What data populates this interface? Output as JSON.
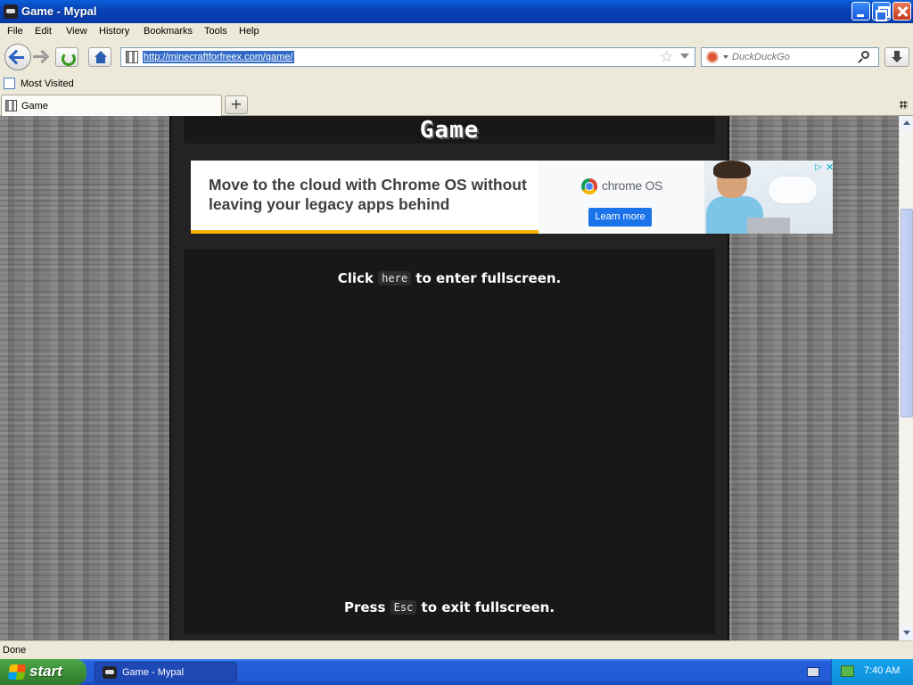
{
  "window": {
    "title": "Game - Mypal"
  },
  "menu": [
    "File",
    "Edit",
    "View",
    "History",
    "Bookmarks",
    "Tools",
    "Help"
  ],
  "toolbar": {
    "url": "http://minecraftforfreex.com/game/",
    "search_placeholder": "DuckDuckGo"
  },
  "bookmarks": {
    "most_visited": "Most Visited"
  },
  "tabs": [
    {
      "label": "Game",
      "active": true
    }
  ],
  "page": {
    "title": "Game",
    "ad": {
      "headline": "Move to the cloud with Chrome OS without leaving your legacy apps behind",
      "brand": "chrome OS",
      "cta": "Learn more",
      "accent_color": "#f4b400",
      "button_color": "#1a73e8"
    },
    "line1": {
      "before": "Click",
      "key": "here",
      "after": "to enter fullscreen."
    },
    "line2": {
      "before": "Press",
      "key": "Esc",
      "after": "to exit fullscreen."
    }
  },
  "status": {
    "text": "Done"
  },
  "taskbar": {
    "start_label": "start",
    "items": [
      {
        "label": "Game - Mypal"
      }
    ],
    "clock": "7:40 AM"
  }
}
